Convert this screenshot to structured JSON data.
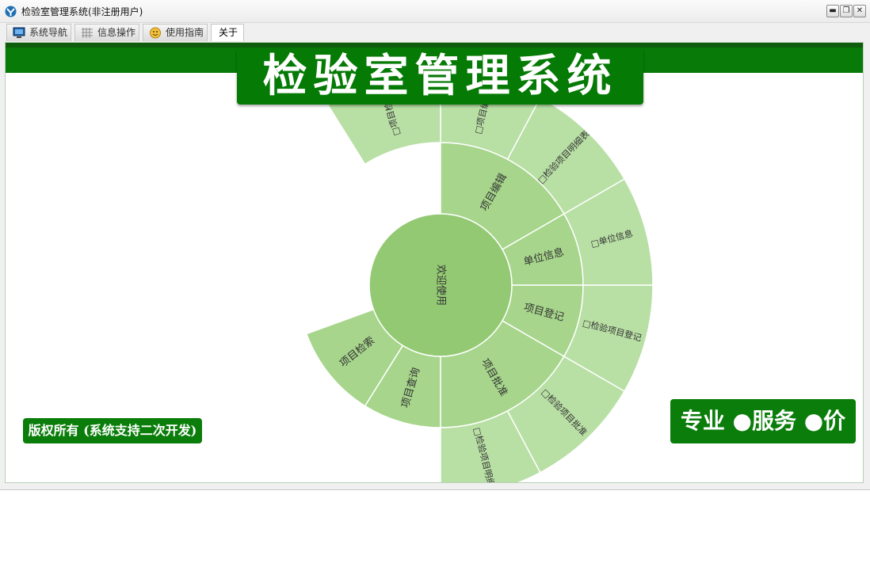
{
  "window": {
    "title": "检验室管理系统(非注册用户)",
    "buttons": {
      "minimize": "▬",
      "restore": "❐",
      "close": "✕"
    }
  },
  "tabs": [
    {
      "label": "系统导航",
      "icon": "monitor-icon",
      "active": false
    },
    {
      "label": "信息操作",
      "icon": "grid-icon",
      "active": false
    },
    {
      "label": "使用指南",
      "icon": "smiley-icon",
      "active": false
    },
    {
      "label": "关于",
      "icon": "",
      "active": true
    }
  ],
  "banner": {
    "title": "检验室管理系统"
  },
  "sunburst": {
    "center": "欢迎使用",
    "middle": [
      "项目查询",
      "项目批准",
      "项目登记",
      "单位信息",
      "项目编辑",
      "项目检索"
    ],
    "outer": [
      "□检验项目明细",
      "□检验项目批准",
      "□检验项目登记",
      "□单位信息",
      "□检验项目明细表",
      "□项目编辑",
      "□项目检索"
    ],
    "colors": {
      "center": "#93c973",
      "middle": "#a6d58b",
      "outer": "#b8dfa4"
    }
  },
  "footer": {
    "copyright": "版权所有 (系统支持二次开发)",
    "slogan": "专业 ●服务 ●价值"
  },
  "colors": {
    "brand_green": "#0a7d0a"
  }
}
